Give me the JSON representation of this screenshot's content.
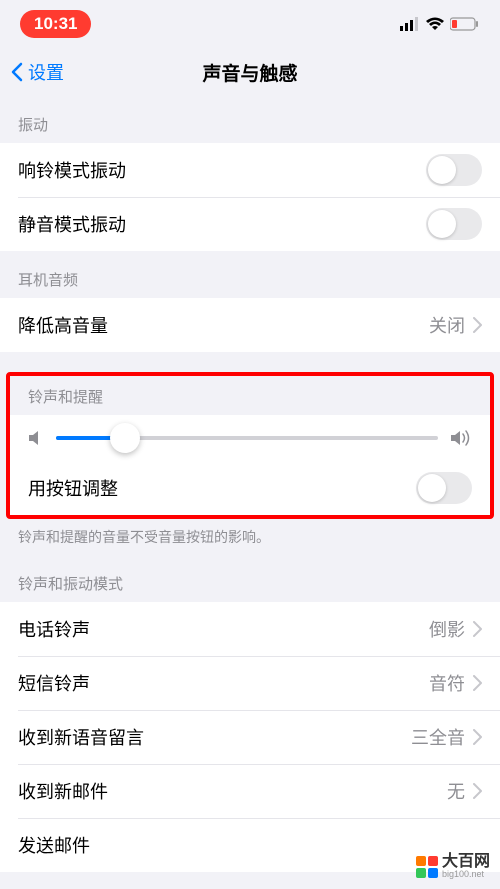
{
  "status": {
    "time": "10:31"
  },
  "nav": {
    "back": "设置",
    "title": "声音与触感"
  },
  "sections": {
    "vibrate": {
      "header": "振动",
      "ring": "响铃模式振动",
      "silent": "静音模式振动"
    },
    "headphone": {
      "header": "耳机音频",
      "reduceLoud": "降低高音量",
      "reduceLoudValue": "关闭"
    },
    "ringer": {
      "header": "铃声和提醒",
      "buttonAdjust": "用按钮调整",
      "footer": "铃声和提醒的音量不受音量按钮的影响。"
    },
    "sounds": {
      "header": "铃声和振动模式",
      "ringtone": {
        "label": "电话铃声",
        "value": "倒影"
      },
      "textTone": {
        "label": "短信铃声",
        "value": "音符"
      },
      "voicemail": {
        "label": "收到新语音留言",
        "value": "三全音"
      },
      "newMail": {
        "label": "收到新邮件",
        "value": "无"
      },
      "sentMail": {
        "label": "发送邮件"
      }
    }
  },
  "watermark": {
    "cn": "大百网",
    "en": "big100.net"
  }
}
